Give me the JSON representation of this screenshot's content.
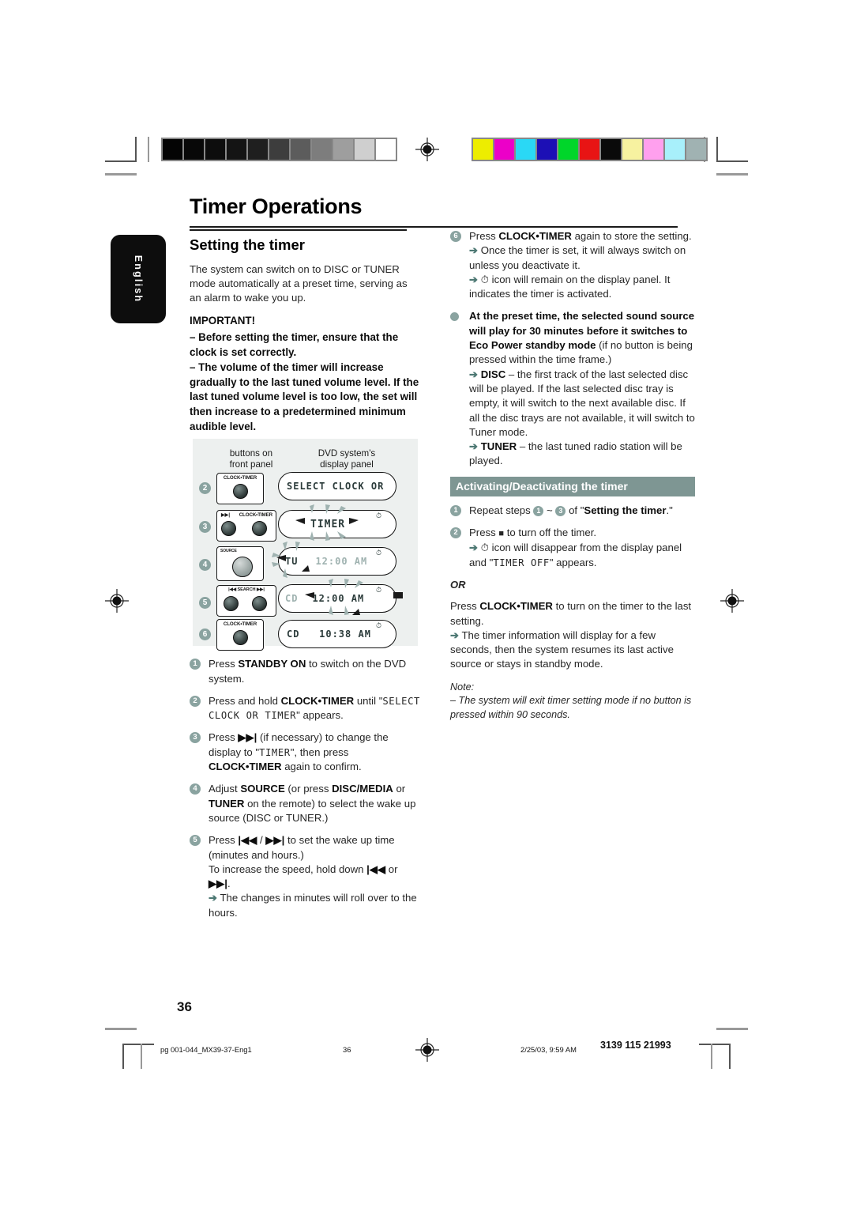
{
  "page": {
    "title": "Timer Operations",
    "language_tab": "English",
    "page_number": "36"
  },
  "colorbar": {
    "grayscale": [
      "#040404",
      "#080808",
      "#0d0d0d",
      "#141414",
      "#1f1f1f",
      "#3d3d3d",
      "#5c5c5c",
      "#7d7d7d",
      "#9e9e9e",
      "#cfcfcf",
      "#ffffff"
    ],
    "colors": [
      "#eded00",
      "#ec00c8",
      "#2ad8f5",
      "#1c0fb5",
      "#00d62a",
      "#e81414",
      "#0a0a0a",
      "#f7f2a0",
      "#ffa0ee",
      "#a8f0fb",
      "#a0b2b2"
    ]
  },
  "left": {
    "section_title": "Setting the timer",
    "intro": "The system can switch on to DISC or TUNER mode automatically at a preset time, serving as an alarm to wake you up.",
    "important_label": "IMPORTANT!",
    "important_items": [
      "–  Before setting the timer, ensure that the clock is set correctly.",
      "–  The volume of the timer will increase gradually to the last tuned volume level. If the last tuned volume level is too low, the set will then increase to a predetermined minimum audible level."
    ],
    "diagram": {
      "label_left_line1": "buttons on",
      "label_left_line2": "front panel",
      "label_right_line1": "DVD system's",
      "label_right_line2": "display panel",
      "rows": [
        {
          "num": "2",
          "buttons": [
            "CLOCK•TIMER"
          ],
          "display": "SELECT CLOCK OR",
          "clock_icon": false
        },
        {
          "num": "3",
          "buttons": [
            "▶▶|",
            "CLOCK•TIMER"
          ],
          "display": "TIMER",
          "clock_icon": true
        },
        {
          "num": "4",
          "buttons": [
            "SOURCE"
          ],
          "display": "TU  12:00 AM",
          "clock_icon": true
        },
        {
          "num": "5",
          "buttons": [
            "|◀◀ SEARCH ▶▶|"
          ],
          "display": "CD  12:00 AM",
          "clock_icon": true
        },
        {
          "num": "6",
          "buttons": [
            "CLOCK•TIMER"
          ],
          "display": "CD  10:38 AM",
          "clock_icon": true
        }
      ]
    },
    "steps": [
      {
        "num": "1",
        "parts": [
          {
            "t": "Press ",
            "s": "n"
          },
          {
            "t": "STANDBY ON",
            "s": "b"
          },
          {
            "t": " to switch on the DVD system.",
            "s": "n"
          }
        ]
      },
      {
        "num": "2",
        "parts": [
          {
            "t": "Press and hold ",
            "s": "n"
          },
          {
            "t": "CLOCK•TIMER",
            "s": "b"
          },
          {
            "t": " until \"",
            "s": "n"
          },
          {
            "t": "SELECT CLOCK OR TIMER",
            "s": "l"
          },
          {
            "t": "\" appears.",
            "s": "n"
          }
        ]
      },
      {
        "num": "3",
        "parts": [
          {
            "t": "Press ",
            "s": "n"
          },
          {
            "t": "▶▶|",
            "s": "b"
          },
          {
            "t": " (if necessary) to change the display to \"",
            "s": "n"
          },
          {
            "t": "TIMER",
            "s": "l"
          },
          {
            "t": "\", then press ",
            "s": "n"
          },
          {
            "t": "CLOCK•TIMER",
            "s": "b"
          },
          {
            "t": " again to confirm.",
            "s": "n"
          }
        ]
      },
      {
        "num": "4",
        "parts": [
          {
            "t": "Adjust ",
            "s": "n"
          },
          {
            "t": "SOURCE",
            "s": "b"
          },
          {
            "t": " (or press ",
            "s": "n"
          },
          {
            "t": "DISC/MEDIA",
            "s": "b"
          },
          {
            "t": " or ",
            "s": "n"
          },
          {
            "t": "TUNER",
            "s": "b"
          },
          {
            "t": " on the remote) to select the wake up source (DISC or TUNER.)",
            "s": "n"
          }
        ]
      },
      {
        "num": "5",
        "parts": [
          {
            "t": "Press ",
            "s": "n"
          },
          {
            "t": "|◀◀",
            "s": "b"
          },
          {
            "t": " / ",
            "s": "n"
          },
          {
            "t": "▶▶|",
            "s": "b"
          },
          {
            "t": " to set the wake up time (minutes and hours.)",
            "s": "n"
          },
          {
            "t": "BR",
            "s": "br"
          },
          {
            "t": "To increase the speed, hold down ",
            "s": "n"
          },
          {
            "t": "|◀◀",
            "s": "b"
          },
          {
            "t": " or ",
            "s": "n"
          },
          {
            "t": "▶▶|",
            "s": "b"
          },
          {
            "t": ".",
            "s": "n"
          },
          {
            "t": "BR",
            "s": "br"
          },
          {
            "t": "➔",
            "s": "a"
          },
          {
            "t": " The changes in minutes will roll over to the hours.",
            "s": "n"
          }
        ]
      }
    ]
  },
  "right": {
    "steps": [
      {
        "num": "6",
        "parts": [
          {
            "t": "Press ",
            "s": "n"
          },
          {
            "t": "CLOCK•TIMER",
            "s": "b"
          },
          {
            "t": " again to store the setting.",
            "s": "n"
          },
          {
            "t": "BR",
            "s": "br"
          },
          {
            "t": "➔",
            "s": "a"
          },
          {
            "t": " Once the timer is set, it will always switch on unless you deactivate it.",
            "s": "n"
          },
          {
            "t": "BR",
            "s": "br"
          },
          {
            "t": "➔",
            "s": "a"
          },
          {
            "t": " ⏱ icon will remain on the display panel.  It indicates the timer is activated.",
            "s": "n"
          }
        ]
      },
      {
        "num": "•",
        "parts": [
          {
            "t": "At the preset time, the selected sound source will play for 30 minutes before it switches to Eco Power standby mode",
            "s": "b"
          },
          {
            "t": " (if no button is being pressed within the time frame.)",
            "s": "n"
          },
          {
            "t": "BR",
            "s": "br"
          },
          {
            "t": "➔",
            "s": "a"
          },
          {
            "t": " ",
            "s": "n"
          },
          {
            "t": "DISC",
            "s": "b"
          },
          {
            "t": " – the first track of the last selected disc will be played.  If the last selected disc tray is empty, it will switch to the next available disc.  If all the disc trays are not available, it will switch to Tuner mode.",
            "s": "n"
          },
          {
            "t": "BR",
            "s": "br"
          },
          {
            "t": "➔",
            "s": "a"
          },
          {
            "t": " ",
            "s": "n"
          },
          {
            "t": "TUNER",
            "s": "b"
          },
          {
            "t": " – the last tuned radio station will be played.",
            "s": "n"
          }
        ]
      }
    ],
    "banner": "Activating/Deactivating the timer",
    "steps2": [
      {
        "num": "1",
        "parts": [
          {
            "t": "Repeat steps ",
            "s": "n"
          },
          {
            "t": "1",
            "s": "c"
          },
          {
            "t": " ~ ",
            "s": "n"
          },
          {
            "t": "3",
            "s": "c"
          },
          {
            "t": " of \"",
            "s": "n"
          },
          {
            "t": "Setting the timer",
            "s": "b"
          },
          {
            "t": ".\"",
            "s": "n"
          }
        ]
      },
      {
        "num": "2",
        "parts": [
          {
            "t": "Press ",
            "s": "n"
          },
          {
            "t": "■",
            "s": "sq"
          },
          {
            "t": " to turn off the timer.",
            "s": "n"
          },
          {
            "t": "BR",
            "s": "br"
          },
          {
            "t": "➔",
            "s": "a"
          },
          {
            "t": " ⏱ icon will disappear from the display panel and \"",
            "s": "n"
          },
          {
            "t": "TIMER OFF",
            "s": "l"
          },
          {
            "t": "\" appears.",
            "s": "n"
          }
        ]
      }
    ],
    "or_label": "OR",
    "or_body": [
      {
        "t": "Press ",
        "s": "n"
      },
      {
        "t": "CLOCK•TIMER",
        "s": "b"
      },
      {
        "t": " to turn on the timer to the last setting.",
        "s": "n"
      },
      {
        "t": "BR",
        "s": "br"
      },
      {
        "t": "➔",
        "s": "a"
      },
      {
        "t": " The timer information will display for a few seconds, then the system resumes its last active source or stays in standby mode.",
        "s": "n"
      }
    ],
    "note_label": "Note:",
    "note_body": "–  The system will exit timer setting mode if no button is pressed within 90 seconds."
  },
  "footer": {
    "file": "pg 001-044_MX39-37-Eng1",
    "page": "36",
    "timestamp": "2/25/03, 9:59 AM",
    "code": "3139 115 21993"
  }
}
